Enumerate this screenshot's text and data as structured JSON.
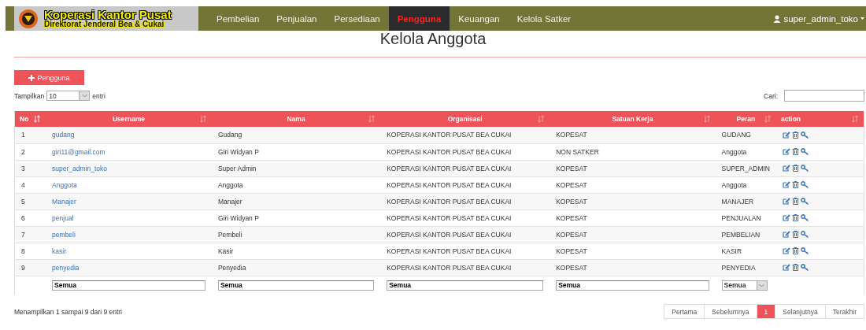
{
  "brand": {
    "title": "Koperasi Kantor Pusat",
    "subtitle": "Direktorat Jenderal Bea & Cukai"
  },
  "nav": [
    {
      "label": "Pembelian",
      "selected": false
    },
    {
      "label": "Penjualan",
      "selected": false
    },
    {
      "label": "Persediaan",
      "selected": false
    },
    {
      "label": "Pengguna",
      "selected": true
    },
    {
      "label": "Keuangan",
      "selected": false
    },
    {
      "label": "Kelola Satker",
      "selected": false
    }
  ],
  "user_menu": {
    "label": "super_admin_toko"
  },
  "page_title": "Kelola Anggota",
  "add_button": "Pengguna",
  "length": {
    "label_before": "Tampilkan",
    "value": "10",
    "label_after": "entri"
  },
  "search": {
    "label": "Cari:"
  },
  "table": {
    "columns": [
      {
        "label": "No",
        "sorted": true
      },
      {
        "label": "Username",
        "sorted": false
      },
      {
        "label": "Nama",
        "sorted": false
      },
      {
        "label": "Organisasi",
        "sorted": false
      },
      {
        "label": "Satuan Kerja",
        "sorted": false
      },
      {
        "label": "Peran",
        "sorted": false
      },
      {
        "label": "action",
        "sorted": false
      }
    ],
    "rows": [
      {
        "no": "1",
        "username": "gudang",
        "nama": "Gudang",
        "organisasi": "KOPERASI KANTOR PUSAT BEA CUKAI",
        "satuan_kerja": "KOPESAT",
        "peran": "GUDANG"
      },
      {
        "no": "2",
        "username": "giri11@gmail.com",
        "nama": "Giri Widyan P",
        "organisasi": "KOPERASI KANTOR PUSAT BEA CUKAI",
        "satuan_kerja": "NON SATKER",
        "peran": "Anggota"
      },
      {
        "no": "3",
        "username": "super_admin_toko",
        "nama": "Super Admin",
        "organisasi": "KOPERASI KANTOR PUSAT BEA CUKAI",
        "satuan_kerja": "KOPESAT",
        "peran": "SUPER_ADMIN"
      },
      {
        "no": "4",
        "username": "Anggota",
        "nama": "Anggota",
        "organisasi": "KOPERASI KANTOR PUSAT BEA CUKAI",
        "satuan_kerja": "KOPESAT",
        "peran": "Anggota"
      },
      {
        "no": "5",
        "username": "Manajer",
        "nama": "Manajer",
        "organisasi": "KOPERASI KANTOR PUSAT BEA CUKAI",
        "satuan_kerja": "KOPESAT",
        "peran": "MANAJER"
      },
      {
        "no": "6",
        "username": "penjual",
        "nama": "Giri Widyan P",
        "organisasi": "KOPERASI KANTOR PUSAT BEA CUKAI",
        "satuan_kerja": "KOPESAT",
        "peran": "PENJUALAN"
      },
      {
        "no": "7",
        "username": "pembeli",
        "nama": "Pembeli",
        "organisasi": "KOPERASI KANTOR PUSAT BEA CUKAI",
        "satuan_kerja": "KOPESAT",
        "peran": "PEMBELIAN"
      },
      {
        "no": "8",
        "username": "kasir",
        "nama": "Kasir",
        "organisasi": "KOPERASI KANTOR PUSAT BEA CUKAI",
        "satuan_kerja": "KOPESAT",
        "peran": "KASIR"
      },
      {
        "no": "9",
        "username": "penyedia",
        "nama": "Penyedia",
        "organisasi": "KOPERASI KANTOR PUSAT BEA CUKAI",
        "satuan_kerja": "KOPESAT",
        "peran": "PENYEDIA"
      }
    ],
    "filters": [
      {
        "kind": "empty"
      },
      {
        "kind": "text",
        "value": "Semua"
      },
      {
        "kind": "text",
        "value": "Semua"
      },
      {
        "kind": "text",
        "value": "Semua"
      },
      {
        "kind": "text",
        "value": "Semua"
      },
      {
        "kind": "select",
        "value": "Semua"
      },
      {
        "kind": "empty"
      }
    ]
  },
  "info": "Menampilkan 1 sampai 9 dari 9 entri",
  "pagination": [
    {
      "label": "Pertama",
      "selected": false
    },
    {
      "label": "Sebelumnya",
      "selected": false
    },
    {
      "label": "1",
      "selected": true
    },
    {
      "label": "Selanjutnya",
      "selected": false
    },
    {
      "label": "Terakhir",
      "selected": false
    }
  ]
}
